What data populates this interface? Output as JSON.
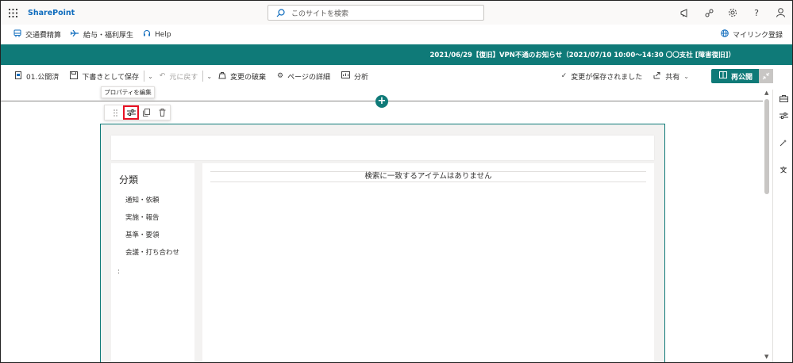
{
  "suitebar": {
    "app_name": "SharePoint",
    "search_placeholder": "このサイトを検索"
  },
  "hubnav": {
    "links": [
      "交通費精算",
      "給与・福利厚生",
      "Help"
    ],
    "my_links": "マイリンク登録"
  },
  "banner": {
    "text": "2021/06/29【復旧】VPN不通のお知らせ（2021/07/10 10:00～14:30 〇〇支社 [障害復旧]）"
  },
  "commandbar": {
    "page_name": "01.公開済",
    "save_draft": "下書きとして保存",
    "undo": "元に戻す",
    "discard": "変更の破棄",
    "page_details": "ページの詳細",
    "analytics": "分析",
    "saved_status": "変更が保存されました",
    "share": "共有",
    "republish": "再公開"
  },
  "canvas": {
    "tooltip": "プロパティを編集"
  },
  "webpart": {
    "category_title": "分類",
    "categories": [
      "通知・依頼",
      "実施・報告",
      "基準・要領",
      "会議・打ち合わせ"
    ],
    "colon": ":",
    "no_items": "検索に一致するアイテムはありません"
  },
  "colors": {
    "accent": "#0f7a78",
    "brand": "#0f6cbd",
    "highlight": "#e81123"
  }
}
